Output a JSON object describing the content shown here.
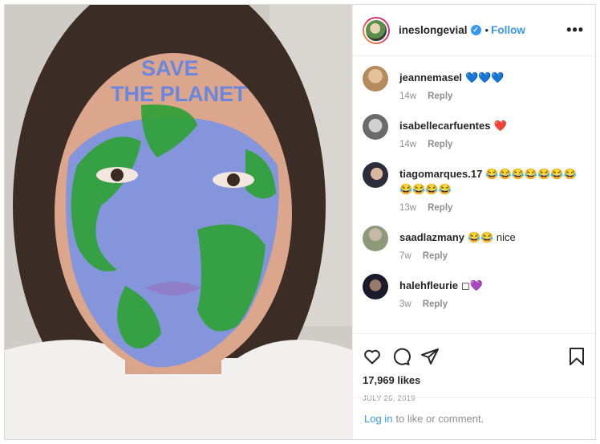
{
  "post": {
    "username": "ineslongevial",
    "verified_mark": "✓",
    "separator": "•",
    "follow_label": "Follow",
    "more_label": "•••",
    "photo_text_line1": "SAVE",
    "photo_text_line2": "THE PLANET"
  },
  "comments": [
    {
      "user": "jeannemasel",
      "text": "💙💙💙",
      "time": "14w",
      "reply": "Reply",
      "avatar_color": "#b58a5c"
    },
    {
      "user": "isabellecarfuentes",
      "text": "❤️",
      "time": "14w",
      "reply": "Reply",
      "avatar_color": "#8a8a8a"
    },
    {
      "user": "tiagomarques.17",
      "text": "😂😂😂😂😂😂😂😂😂😂😂",
      "time": "13w",
      "reply": "Reply",
      "avatar_color": "#2c2c3a"
    },
    {
      "user": "saadlazmany",
      "text": "😂😂 nice",
      "time": "7w",
      "reply": "Reply",
      "avatar_color": "#6b7a5a"
    },
    {
      "user": "halehfleurie",
      "text": "◻💜",
      "time": "3w",
      "reply": "Reply",
      "avatar_color": "#1a1a2a"
    }
  ],
  "likes_label": "17,969 likes",
  "date_label": "JULY 26, 2019",
  "login": {
    "link": "Log in",
    "rest": "to like or comment."
  },
  "icons": [
    "heart-icon",
    "comment-icon",
    "share-icon",
    "bookmark-icon"
  ],
  "colors": {
    "accent": "#3897f0",
    "muted": "#8e8e8e",
    "paint_blue": "#7f94e0",
    "paint_green": "#2ea134"
  }
}
